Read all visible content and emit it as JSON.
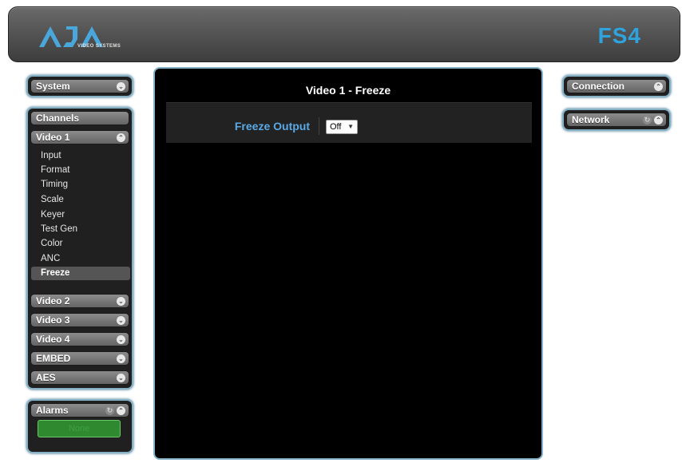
{
  "header": {
    "logo_text": "AJA",
    "logo_subtext": "VIDEO SYSTEMS",
    "model": "FS4"
  },
  "system": {
    "label": "System",
    "icon": "chevron-down-icon"
  },
  "channels": {
    "title": "Channels",
    "video1": {
      "label": "Video 1",
      "items": [
        "Input",
        "Format",
        "Timing",
        "Scale",
        "Keyer",
        "Test Gen",
        "Color",
        "ANC",
        "Freeze"
      ],
      "selected": "Freeze"
    },
    "groups": [
      "Video 2",
      "Video 3",
      "Video 4",
      "EMBED",
      "AES"
    ]
  },
  "alarms": {
    "label": "Alarms",
    "status": "None"
  },
  "content": {
    "title": "Video 1 - Freeze",
    "param_label": "Freeze Output",
    "param_value": "Off"
  },
  "right": {
    "connection": "Connection",
    "network": "Network"
  },
  "colors": {
    "accent": "#2fa3dd",
    "panel_border": "#86b2c8",
    "label_blue": "#5aa9e6",
    "status_green": "#2f8a2f"
  }
}
